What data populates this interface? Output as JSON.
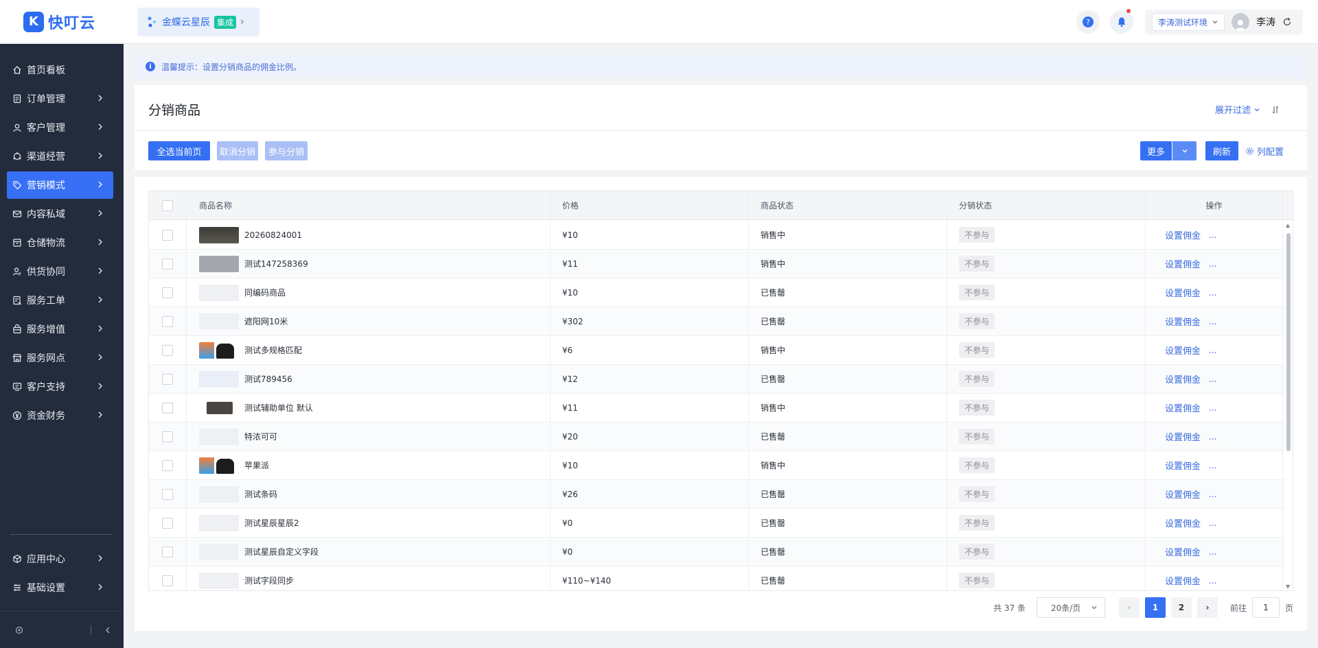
{
  "logo": {
    "text": "快叮云",
    "mark": "K"
  },
  "sidebar": {
    "items": [
      {
        "label": "首页看板",
        "icon": "home-icon",
        "arrow": false
      },
      {
        "label": "订单管理",
        "icon": "order-icon",
        "arrow": true
      },
      {
        "label": "客户管理",
        "icon": "user-icon",
        "arrow": true
      },
      {
        "label": "渠道经营",
        "icon": "channel-icon",
        "arrow": true
      },
      {
        "label": "营销模式",
        "icon": "tag-icon",
        "arrow": true,
        "active": true
      },
      {
        "label": "内容私域",
        "icon": "mail-icon",
        "arrow": true
      },
      {
        "label": "仓储物流",
        "icon": "warehouse-icon",
        "arrow": true
      },
      {
        "label": "供货协同",
        "icon": "supply-icon",
        "arrow": true
      },
      {
        "label": "服务工单",
        "icon": "ticket-icon",
        "arrow": true
      },
      {
        "label": "服务增值",
        "icon": "bag-icon",
        "arrow": true
      },
      {
        "label": "服务网点",
        "icon": "store-icon",
        "arrow": true
      },
      {
        "label": "客户支持",
        "icon": "support-icon",
        "arrow": true
      },
      {
        "label": "资金财务",
        "icon": "finance-icon",
        "arrow": true
      }
    ],
    "bottom_items": [
      {
        "label": "应用中心",
        "icon": "cube-icon"
      },
      {
        "label": "基础设置",
        "icon": "settings-list-icon"
      }
    ]
  },
  "header": {
    "brand": "金蝶云星辰",
    "brand_badge": "集成",
    "env": "李涛测试环境",
    "user": "李涛"
  },
  "notice": {
    "text": "温馨提示：设置分销商品的佣金比例。"
  },
  "panel": {
    "title": "分销商品",
    "expand_filter": "展开过滤",
    "buttons": {
      "select_page": "全选当前页",
      "cancel_dist": "取消分销",
      "join_dist": "参与分销",
      "more": "更多",
      "refresh": "刷新",
      "col_config": "列配置"
    }
  },
  "table": {
    "columns": [
      "商品名称",
      "价格",
      "商品状态",
      "分销状态",
      "操作"
    ],
    "rows": [
      {
        "name": "20260824001",
        "price": "¥10",
        "status": "销售中",
        "dist": "不参与",
        "thumb": "keyboard"
      },
      {
        "name": "测试147258369",
        "price": "¥11",
        "status": "销售中",
        "dist": "不参与",
        "thumb": "grey"
      },
      {
        "name": "同编码商品",
        "price": "¥10",
        "status": "已售罄",
        "dist": "不参与",
        "thumb": "blank"
      },
      {
        "name": "遮阳网10米",
        "price": "¥302",
        "status": "已售罄",
        "dist": "不参与",
        "thumb": "blank"
      },
      {
        "name": "测试多规格匹配",
        "price": "¥6",
        "status": "销售中",
        "dist": "不参与",
        "thumb": "multi"
      },
      {
        "name": "测试789456",
        "price": "¥12",
        "status": "已售罄",
        "dist": "不参与",
        "thumb": "light"
      },
      {
        "name": "测试辅助单位 默认",
        "price": "¥11",
        "status": "销售中",
        "dist": "不参与",
        "thumb": "bag"
      },
      {
        "name": "特浓可可",
        "price": "¥20",
        "status": "已售罄",
        "dist": "不参与",
        "thumb": "blank"
      },
      {
        "name": "苹果派",
        "price": "¥10",
        "status": "销售中",
        "dist": "不参与",
        "thumb": "multi"
      },
      {
        "name": "测试条码",
        "price": "¥26",
        "status": "已售罄",
        "dist": "不参与",
        "thumb": "blank"
      },
      {
        "name": "测试星辰星辰2",
        "price": "¥0",
        "status": "已售罄",
        "dist": "不参与",
        "thumb": "blank"
      },
      {
        "name": "测试星辰自定义字段",
        "price": "¥0",
        "status": "已售罄",
        "dist": "不参与",
        "thumb": "blank"
      },
      {
        "name": "测试字段同步",
        "price": "¥110~¥140",
        "status": "已售罄",
        "dist": "不参与",
        "thumb": "blank"
      }
    ],
    "op_link": "设置佣金",
    "op_more": "..."
  },
  "pagination": {
    "total": "共 37 条",
    "page_size": "20条/页",
    "pages": [
      "1",
      "2"
    ],
    "current": "1",
    "goto_label": "前往",
    "goto_value": "1",
    "goto_suffix": "页"
  },
  "colors": {
    "primary": "#3570f2",
    "sidebar": "#232c3d",
    "link": "#3b6ce0"
  }
}
